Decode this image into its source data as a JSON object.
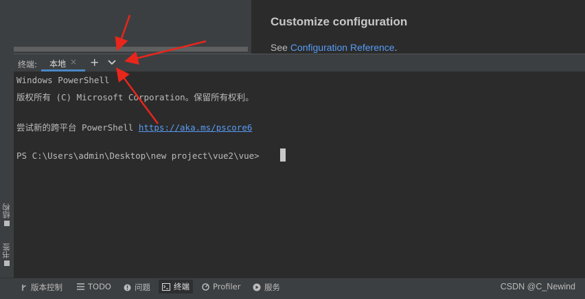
{
  "side_tabs": [
    {
      "label": "结构",
      "icon": "structure-icon"
    },
    {
      "label": "书签",
      "icon": "bookmark-icon"
    }
  ],
  "doc": {
    "title": "Customize configuration",
    "see_prefix": "See ",
    "link": "Configuration Reference",
    "suffix": "."
  },
  "terminal_header": {
    "label": "终端:",
    "tab": "本地",
    "close": "×",
    "add": "+",
    "dropdown": "⌄"
  },
  "terminal": {
    "lines": [
      "Windows PowerShell",
      "版权所有 (C) Microsoft Corporation。保留所有权利。",
      "",
      "尝试新的跨平台 PowerShell ",
      "",
      "PS C:\\Users\\admin\\Desktop\\new project\\vue2\\vue> "
    ],
    "link": "https://aka.ms/pscore6"
  },
  "statusbar": {
    "items": [
      {
        "label": "版本控制",
        "icon": "branch-icon"
      },
      {
        "label": "TODO",
        "icon": "list-icon"
      },
      {
        "label": "问题",
        "icon": "info-icon"
      },
      {
        "label": "终端",
        "icon": "terminal-icon",
        "active": true
      },
      {
        "label": "Profiler",
        "icon": "profiler-icon"
      },
      {
        "label": "服务",
        "icon": "services-icon"
      }
    ],
    "watermark": "CSDN @C_Newind"
  },
  "colors": {
    "accent": "#4a88c7",
    "link": "#589df6",
    "annotation": "#e8261c"
  }
}
